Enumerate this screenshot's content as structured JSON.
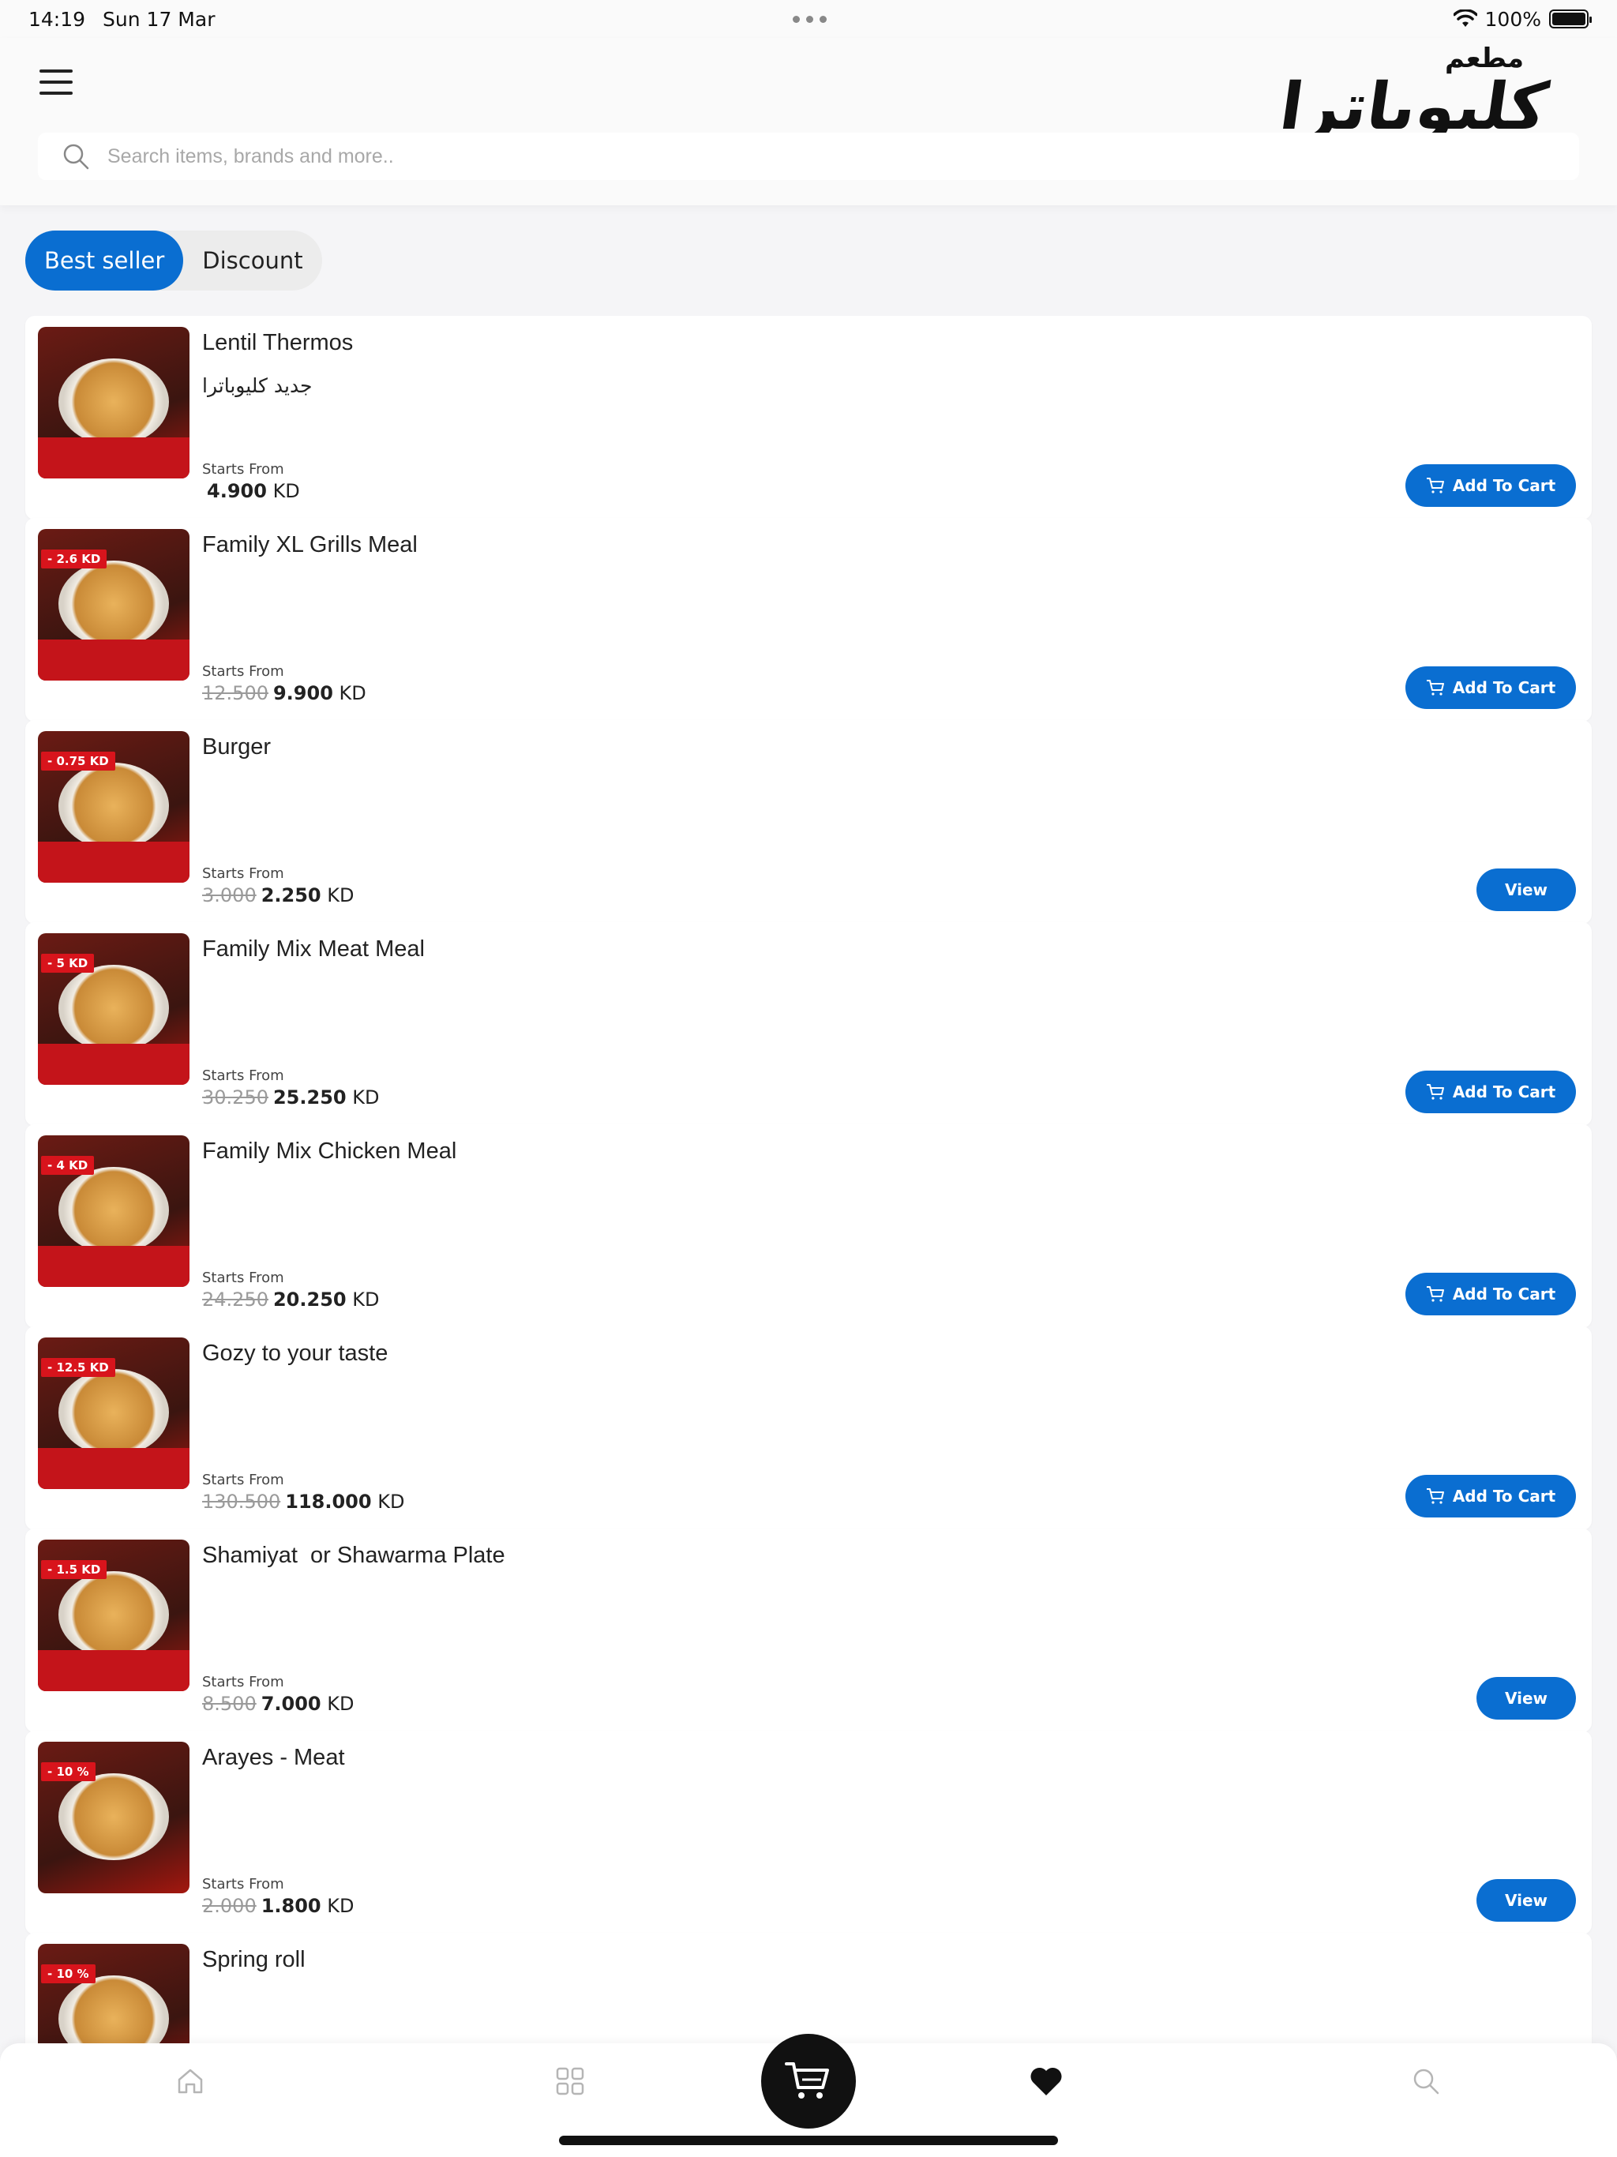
{
  "status_bar": {
    "time": "14:19",
    "date": "Sun 17 Mar",
    "battery": "100%"
  },
  "header": {
    "logo_small": "مطعم",
    "logo_big": "كليوباترا"
  },
  "search": {
    "placeholder": "Search items, brands and more.."
  },
  "tabs": [
    {
      "label": "Best seller",
      "active": true
    },
    {
      "label": "Discount",
      "active": false
    }
  ],
  "products": [
    {
      "title": "Lentil Thermos",
      "subtitle": "جديد كليوباترا",
      "starts_from": "Starts From",
      "old_price": "",
      "price": "4.900",
      "currency": "KD",
      "badge": "",
      "button": "Add To Cart"
    },
    {
      "title": "Family XL Grills Meal",
      "subtitle": "",
      "starts_from": "Starts From",
      "old_price": "12.500",
      "price": "9.900",
      "currency": "KD",
      "badge": "- 2.6 KD",
      "button": "Add To Cart"
    },
    {
      "title": "Burger",
      "subtitle": "",
      "starts_from": "Starts From",
      "old_price": "3.000",
      "price": "2.250",
      "currency": "KD",
      "badge": "- 0.75 KD",
      "button": "View"
    },
    {
      "title": "Family Mix Meat Meal",
      "subtitle": "",
      "starts_from": "Starts From",
      "old_price": "30.250",
      "price": "25.250",
      "currency": "KD",
      "badge": "- 5 KD",
      "button": "Add To Cart"
    },
    {
      "title": "Family Mix Chicken Meal",
      "subtitle": "",
      "starts_from": "Starts From",
      "old_price": "24.250",
      "price": "20.250",
      "currency": "KD",
      "badge": "- 4 KD",
      "button": "Add To Cart"
    },
    {
      "title": "Gozy to your taste",
      "subtitle": "",
      "starts_from": "Starts From",
      "old_price": "130.500",
      "price": "118.000",
      "currency": "KD",
      "badge": "- 12.5 KD",
      "button": "Add To Cart"
    },
    {
      "title": "Shamiyat  or Shawarma Plate",
      "subtitle": "",
      "starts_from": "Starts From",
      "old_price": "8.500",
      "price": "7.000",
      "currency": "KD",
      "badge": "- 1.5 KD",
      "button": "View"
    },
    {
      "title": "Arayes - Meat",
      "subtitle": "",
      "starts_from": "Starts From",
      "old_price": "2.000",
      "price": "1.800",
      "currency": "KD",
      "badge": "- 10 %",
      "button": "View"
    },
    {
      "title": "Spring roll",
      "subtitle": "",
      "starts_from": "",
      "old_price": "",
      "price": "",
      "currency": "",
      "badge": "- 10 %",
      "button": ""
    }
  ],
  "bottom_nav": [
    {
      "icon": "home-icon"
    },
    {
      "icon": "grid-icon"
    },
    {
      "icon": "cart-icon"
    },
    {
      "icon": "heart-icon"
    },
    {
      "icon": "search-icon"
    }
  ],
  "colors": {
    "accent": "#0a6ed1",
    "badge_red": "#d8141c"
  }
}
